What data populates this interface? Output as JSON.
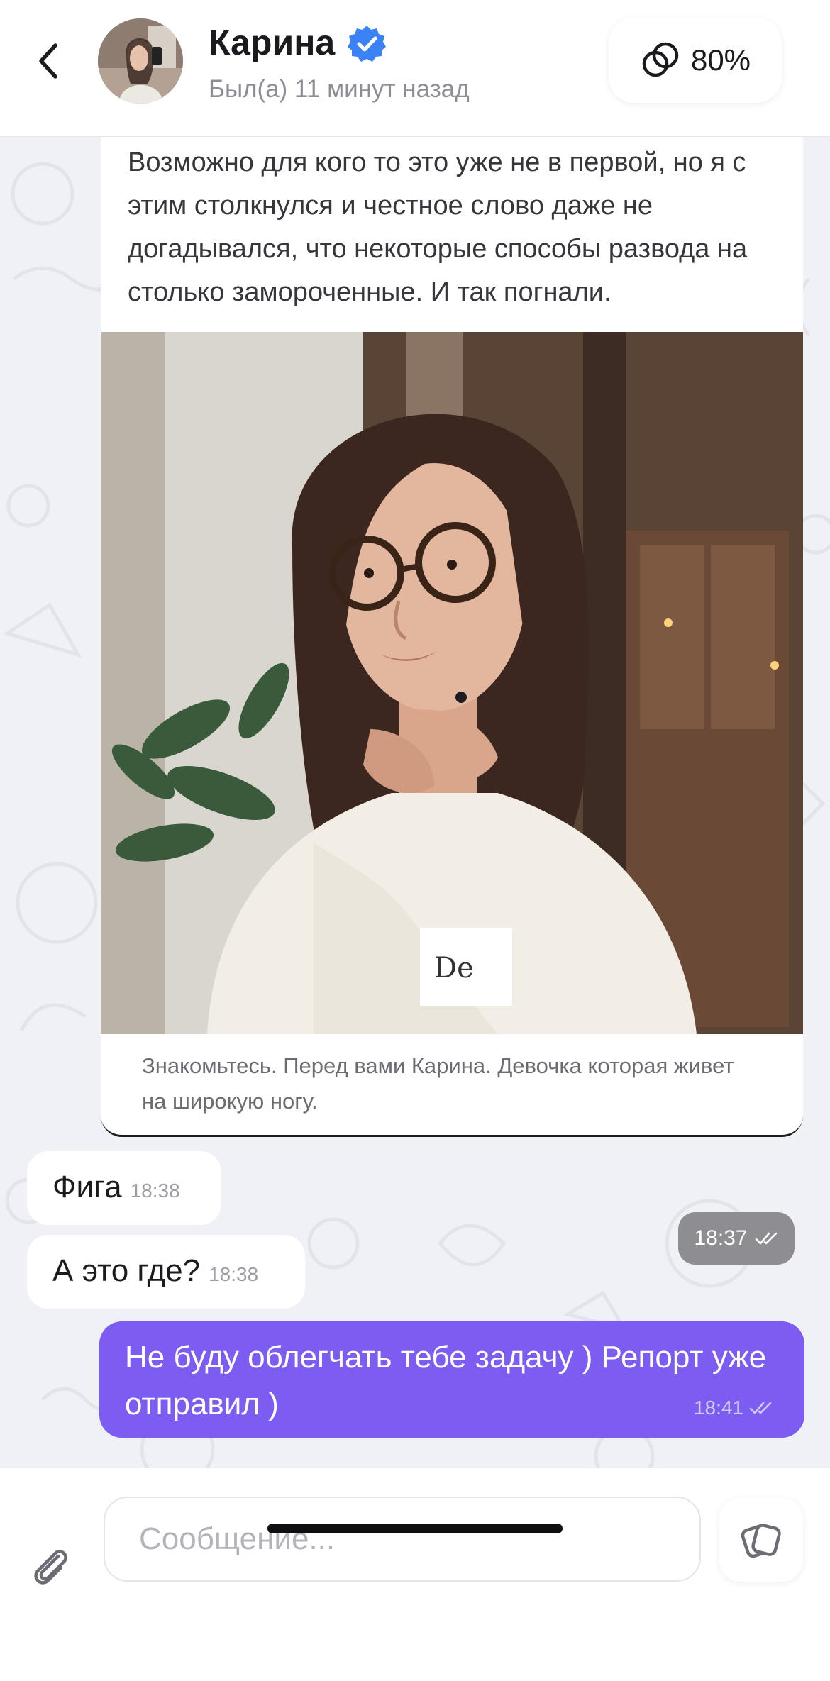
{
  "header": {
    "contact_name": "Карина",
    "last_seen": "Был(а) 11 минут назад",
    "match_percent": "80%",
    "icons": {
      "back": "chevron-left-icon",
      "verified": "verified-badge-icon",
      "match": "interlocking-rings-icon"
    },
    "colors": {
      "verified": "#3b82f6"
    }
  },
  "chat": {
    "post": {
      "text": "Возможно для кого то это уже не в первой, но я с этим столкнулся и честное слово даже не догадывался, что некоторые способы развода на столько замороченные. И так погнали.",
      "caption": "Знакомьтесь. Перед вами Карина. Девочка которая живет на широкую ногу.",
      "time": "18:37"
    },
    "incoming": [
      {
        "text": "Фига",
        "time": "18:38"
      },
      {
        "text": "А это где?",
        "time": "18:38"
      }
    ],
    "outgoing": [
      {
        "text": "Не буду облегчать тебе задачу ) Репорт уже отправил )",
        "time": "18:41"
      }
    ],
    "colors": {
      "outgoing_bubble": "#7c5cf1",
      "background": "#f0f1f6"
    }
  },
  "input": {
    "placeholder": "Сообщение...",
    "value": "",
    "icons": {
      "attach": "paperclip-icon",
      "sticker": "sticker-icon"
    }
  }
}
